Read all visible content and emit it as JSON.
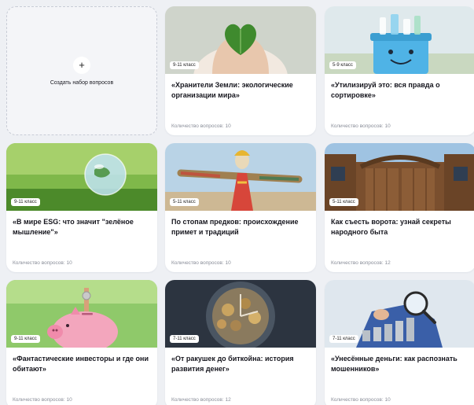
{
  "create": {
    "label": "Создать набор вопросов",
    "icon": "plus-icon"
  },
  "cards": [
    {
      "grade": "9-11 класс",
      "title": "«Хранители Земли: экологические организации мира»",
      "count": "Количество вопросов: 10"
    },
    {
      "grade": "5-9 класс",
      "title": "«Утилизируй это: вся правда о сортировке»",
      "count": "Количество вопросов: 10"
    },
    {
      "grade": "9-11 класс",
      "title": "«В мире ESG: что значит \"зелёное мышление\"»",
      "count": "Количество вопросов: 10"
    },
    {
      "grade": "5-11 класс",
      "title": "По стопам предков: происхождение примет и традиций",
      "count": "Количество вопросов: 10"
    },
    {
      "grade": "5-11 класс",
      "title": "Как съесть ворота: узнай секреты народного быта",
      "count": "Количество вопросов: 12"
    },
    {
      "grade": "9-11 класс",
      "title": "«Фантастические инвесторы и где они обитают»",
      "count": "Количество вопросов: 10"
    },
    {
      "grade": "7-11 класс",
      "title": "«От ракушек до биткойна: история развития денег»",
      "count": "Количество вопросов: 12"
    },
    {
      "grade": "7-11 класс",
      "title": "«Унесённые деньги: как распознать мошенников»",
      "count": "Количество вопросов: 10"
    }
  ]
}
